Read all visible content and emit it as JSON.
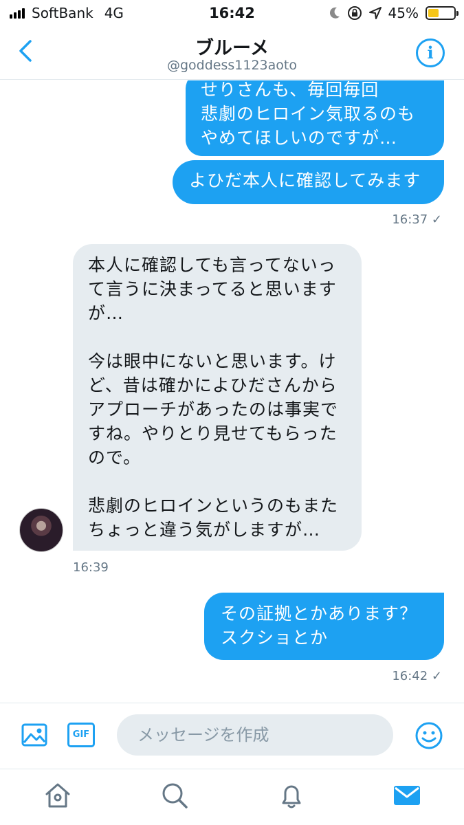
{
  "status_bar": {
    "carrier": "SoftBank",
    "network": "4G",
    "time": "16:42",
    "battery_percent": "45%",
    "battery_color": "#f5c518"
  },
  "header": {
    "title": "ブルーメ",
    "handle": "@goddess1123aoto",
    "back_icon": "chevron-left-icon",
    "info_icon": "info-icon",
    "info_glyph": "i"
  },
  "colors": {
    "accent": "#1da1f2",
    "incoming_bubble": "#e6ecf0",
    "muted": "#657786"
  },
  "messages": [
    {
      "direction": "outgoing",
      "text": "せりさんも、毎回毎回\n悲劇のヒロイン気取るのも\nやめてほしいのですが…"
    },
    {
      "direction": "outgoing",
      "text": "よひだ本人に確認してみます",
      "timestamp": "16:37 ✓"
    },
    {
      "direction": "incoming",
      "text": "本人に確認しても言ってないっ\nて言うに決まってると思います\nが…\n\n今は眼中にないと思います。け\nど、昔は確かによひださんから\nアプローチがあったのは事実で\nすね。やりとり見せてもらった\nので。\n\n悲劇のヒロインというのもまた\nちょっと違う気がしますが…",
      "timestamp": "16:39"
    },
    {
      "direction": "outgoing",
      "text": "その証拠とかあります？\nスクショとか",
      "timestamp": "16:42 ✓"
    }
  ],
  "composer": {
    "placeholder": "メッセージを作成",
    "gif_label": "GIF",
    "image_icon": "image-icon",
    "emoji_icon": "emoji-icon"
  },
  "tab_bar": {
    "items": [
      "home-icon",
      "search-icon",
      "notifications-icon",
      "messages-icon"
    ],
    "active": "messages-icon"
  }
}
